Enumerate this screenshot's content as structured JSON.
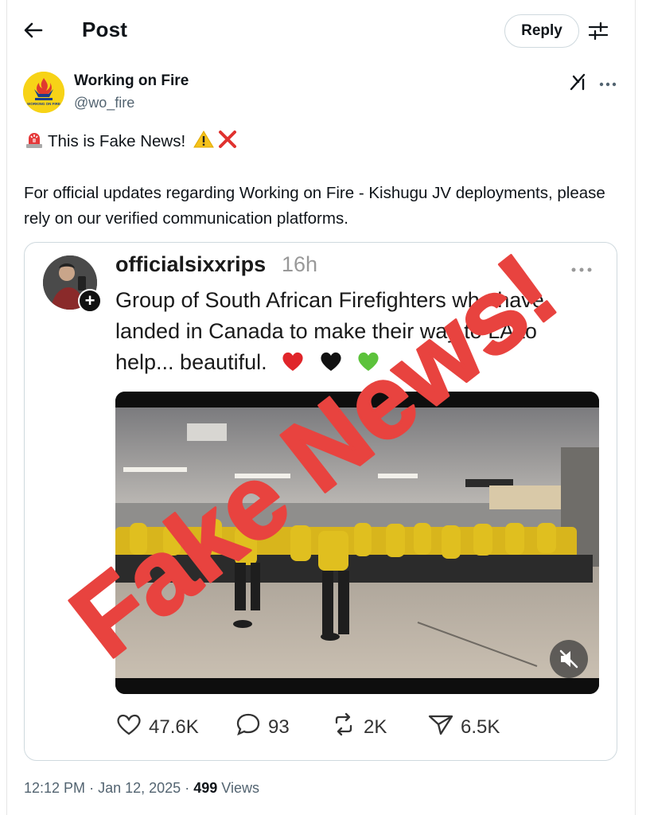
{
  "header": {
    "title": "Post",
    "reply_label": "Reply"
  },
  "author": {
    "name": "Working on Fire",
    "handle": "@wo_fire",
    "logo_text": "WORKING ON FIRE"
  },
  "post": {
    "line1": "This is Fake News!",
    "paragraph": "For official updates regarding Working on Fire - Kishugu JV deployments, please rely on our verified communication platforms."
  },
  "quote": {
    "username": "officialsixxrips",
    "time": "16h",
    "text": "Group of South African Firefighters who have landed in Canada to make their way to LA to help... beautiful.",
    "stats": {
      "likes": "47.6K",
      "comments": "93",
      "reposts": "2K",
      "shares": "6.5K"
    }
  },
  "overlay": {
    "stamp_text": "Fake News!",
    "color": "#e8433f"
  },
  "meta": {
    "time": "12:12 PM",
    "date": "Jan 12, 2025",
    "views_count": "499",
    "views_label": "Views",
    "separator": "·"
  },
  "colors": {
    "secondary_text": "#536471",
    "border": "#cfd9de",
    "stamp_red": "#e8433f"
  }
}
